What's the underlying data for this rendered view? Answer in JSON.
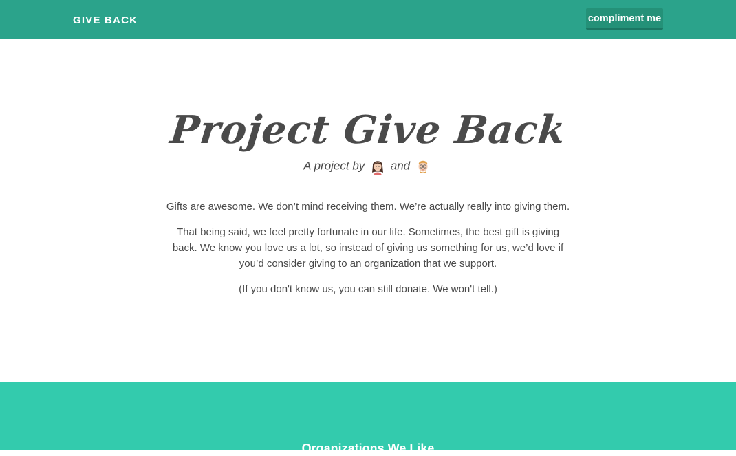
{
  "navbar": {
    "brand": "GIVE BACK",
    "compliment_label": "compliment me"
  },
  "hero": {
    "title": "Project Give Back",
    "byline_prefix": "A project by",
    "byline_and": "and",
    "paragraphs": [
      "Gifts are awesome. We don’t mind receiving them. We’re actually really into giving them.",
      "That being said, we feel pretty fortunate in our life. Sometimes, the best gift is giving back. We know you love us a lot, so instead of giving us something for us, we’d love if you’d consider giving to an organization that we support.",
      "(If you don't know us, you can still donate. We won't tell.)"
    ]
  },
  "organizations": {
    "heading": "Organizations We Like"
  },
  "colors": {
    "navbar": "#2ba38b",
    "button": "#249178",
    "section": "#33cbad",
    "text": "#4a4a4a"
  }
}
